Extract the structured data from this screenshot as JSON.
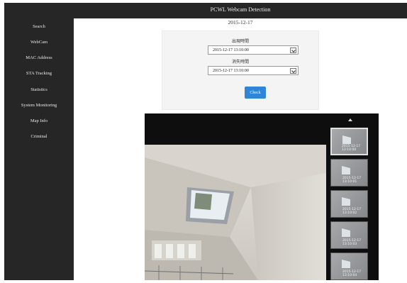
{
  "app": {
    "title": "PCWL Webcam Detection"
  },
  "sidebar": {
    "items": [
      {
        "label": "Search"
      },
      {
        "label": "WebCam"
      },
      {
        "label": "MAC Address"
      },
      {
        "label": "STA Tracking"
      },
      {
        "label": "Statistics"
      },
      {
        "label": "System Monitoring"
      },
      {
        "label": "Map Info"
      },
      {
        "label": "Criminal"
      }
    ]
  },
  "main": {
    "date_heading": "2015-12-17",
    "form": {
      "appear_label": "出現時間",
      "appear_value": "2015-12-17 13:10:00",
      "disappear_label": "消失時間",
      "disappear_value": "2015-12-17 13:10:00",
      "check_label": "Check"
    }
  },
  "viewer": {
    "thumbnails": [
      {
        "date": "2015-12-17",
        "time": "13:10:00",
        "active": true
      },
      {
        "date": "2015-12-17",
        "time": "13:10:01",
        "active": false
      },
      {
        "date": "2015-12-17",
        "time": "13:10:02",
        "active": false
      },
      {
        "date": "2015-12-17",
        "time": "13:10:03",
        "active": false
      },
      {
        "date": "2015-12-17",
        "time": "13:10:04",
        "active": false
      }
    ]
  },
  "colors": {
    "sidebar": "#262626",
    "accent_button": "#2f86d8",
    "panel": "#f4f4f4",
    "viewer": "#0e0e0e"
  }
}
